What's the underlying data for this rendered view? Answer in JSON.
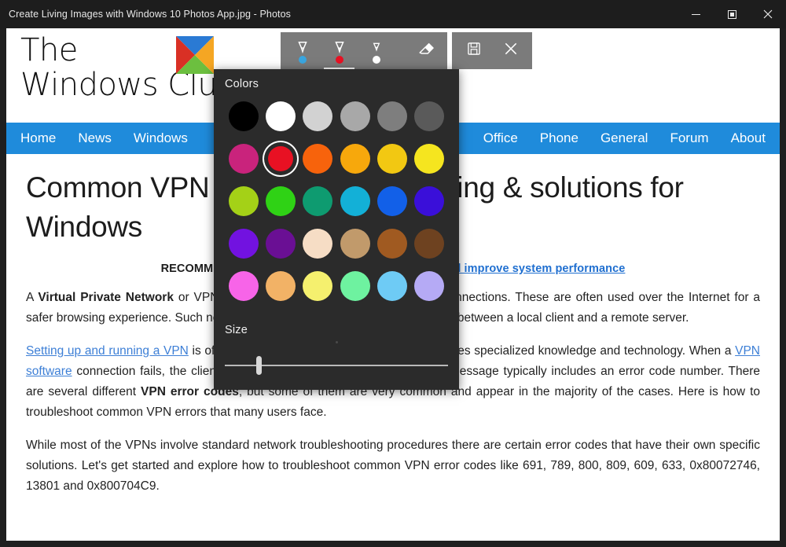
{
  "window": {
    "title": "Create Living Images with Windows 10 Photos App.jpg - Photos",
    "controls": {
      "minimize": "Minimize",
      "maximize": "Maximize",
      "close": "Close"
    }
  },
  "ink_toolbar": {
    "tools": [
      {
        "name": "ballpoint-pen",
        "label": "Ballpoint pen",
        "dot_color": "#3aa6e0",
        "active": false
      },
      {
        "name": "pencil",
        "label": "Pencil",
        "dot_color": "#e81123",
        "active": true
      },
      {
        "name": "calligraphy-pen",
        "label": "Calligraphy pen",
        "dot_color": "#ffffff",
        "active": false
      },
      {
        "name": "eraser",
        "label": "Eraser",
        "dot_color": "",
        "active": false
      }
    ],
    "actions": [
      {
        "name": "save-a-copy",
        "label": "Save a copy"
      },
      {
        "name": "close-inking",
        "label": "Close"
      }
    ]
  },
  "flyout": {
    "colors_label": "Colors",
    "size_label": "Size",
    "selected_color": "#e81123",
    "size_value": 15,
    "swatches": [
      {
        "name": "black",
        "hex": "#000000"
      },
      {
        "name": "white",
        "hex": "#ffffff"
      },
      {
        "name": "light-gray",
        "hex": "#d2d2d2"
      },
      {
        "name": "silver",
        "hex": "#a8a8a8"
      },
      {
        "name": "gray",
        "hex": "#7e7e7e"
      },
      {
        "name": "dark-gray",
        "hex": "#5a5a5a"
      },
      {
        "name": "magenta",
        "hex": "#c9237c"
      },
      {
        "name": "red",
        "hex": "#e81123"
      },
      {
        "name": "orange",
        "hex": "#f7630c"
      },
      {
        "name": "amber",
        "hex": "#f7a80c"
      },
      {
        "name": "gold",
        "hex": "#f2c812"
      },
      {
        "name": "yellow",
        "hex": "#f5e51f"
      },
      {
        "name": "lime",
        "hex": "#a4d117"
      },
      {
        "name": "green",
        "hex": "#2fd215"
      },
      {
        "name": "teal",
        "hex": "#0e9b70"
      },
      {
        "name": "cyan",
        "hex": "#13b0d7"
      },
      {
        "name": "blue",
        "hex": "#1260e8"
      },
      {
        "name": "indigo",
        "hex": "#3a0fd9"
      },
      {
        "name": "violet",
        "hex": "#7212e0"
      },
      {
        "name": "purple",
        "hex": "#6a0f94"
      },
      {
        "name": "cream",
        "hex": "#f6ddc5"
      },
      {
        "name": "tan",
        "hex": "#c19a6b"
      },
      {
        "name": "brown",
        "hex": "#a05a21"
      },
      {
        "name": "dark-brown",
        "hex": "#6e4220"
      },
      {
        "name": "pink",
        "hex": "#f764e8"
      },
      {
        "name": "light-orange",
        "hex": "#f2b266"
      },
      {
        "name": "light-yellow",
        "hex": "#f5f06e"
      },
      {
        "name": "light-green",
        "hex": "#6ef2a0"
      },
      {
        "name": "light-blue",
        "hex": "#6ecbf5"
      },
      {
        "name": "lavender",
        "hex": "#b5aaf5"
      }
    ]
  },
  "page": {
    "logo": {
      "line1": "The",
      "line2": "Windows Club"
    },
    "nav_left": [
      {
        "name": "home",
        "label": "Home"
      },
      {
        "name": "news",
        "label": "News"
      },
      {
        "name": "windows",
        "label": "Windows"
      }
    ],
    "nav_right": [
      {
        "name": "office",
        "label": "Office"
      },
      {
        "name": "phone",
        "label": "Phone"
      },
      {
        "name": "general",
        "label": "General"
      },
      {
        "name": "forum",
        "label": "Forum"
      },
      {
        "name": "about",
        "label": "About"
      }
    ],
    "headline": "Common VPN errors troubleshooting & solutions for Windows",
    "recommended_prefix": "RECOMMENDED: ",
    "recommended_link": "Click here to fix Windows errors and improve system performance",
    "paragraph1": {
      "pre": "A ",
      "bold": "Virtual Private Network",
      "post": " or VPN extends private networks across public connections. These are often used over the Internet for a safer browsing experience. Such networks are encrypted tunnels that are made between a local client and a remote server."
    },
    "paragraph2": {
      "link1": "Setting up and running a VPN",
      "mid1": " is often a difficult and challenging task that requires specialized knowledge and technology. When a ",
      "link2": "VPN software",
      "mid2": " connection fails, the client program reports an error message. This message typically includes an error code number. There are several different ",
      "bold": "VPN error codes",
      "post": ", but some of them are very common and appear in the majority of the cases. Here is how to troubleshoot common VPN errors that many users face."
    },
    "paragraph3": "While most of the VPNs involve standard network troubleshooting procedures there are certain error codes that have their own specific solutions. Let's get started and explore how to troubleshoot common VPN error codes like 691, 789, 800, 809, 609, 633, 0x80072746, 13801 and 0x800704C9."
  },
  "colors": {
    "nav_blue": "#1f8bdb",
    "link_blue": "#3d7fd6",
    "flyout_bg": "#2b2b2b",
    "toolbar_gray": "#7b7b7b",
    "titlebar_bg": "#1d1d1d"
  }
}
